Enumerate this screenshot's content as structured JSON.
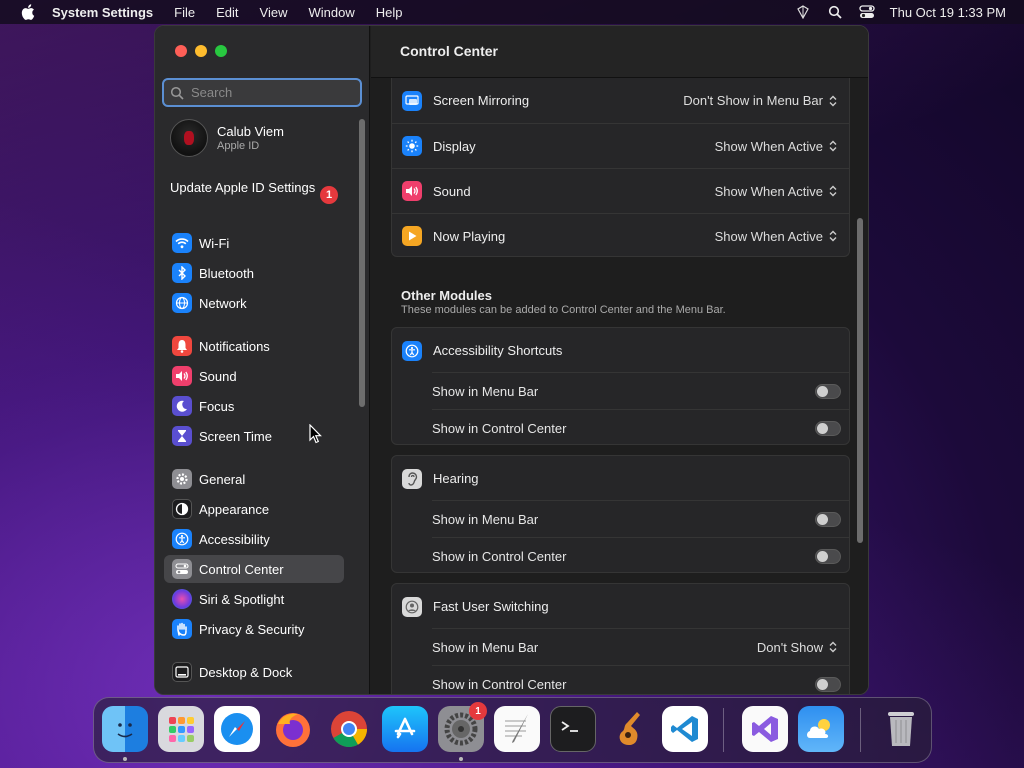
{
  "menubar": {
    "app_name": "System Settings",
    "menus": [
      "File",
      "Edit",
      "View",
      "Window",
      "Help"
    ],
    "clock": "Thu Oct 19  1:33 PM"
  },
  "window": {
    "search": {
      "placeholder": "Search"
    },
    "profile": {
      "name": "Calub Viem",
      "subtitle": "Apple ID"
    },
    "update_notice": {
      "label": "Update Apple ID Settings",
      "badge": "1"
    },
    "sidebar": {
      "items": [
        {
          "label": "Wi-Fi",
          "icon": "wifi-icon",
          "color": "#1a82fb"
        },
        {
          "label": "Bluetooth",
          "icon": "bluetooth-icon",
          "color": "#1a82fb"
        },
        {
          "label": "Network",
          "icon": "globe-icon",
          "color": "#1a82fb"
        },
        {
          "label": "Notifications",
          "icon": "bell-icon",
          "color": "#f0473e"
        },
        {
          "label": "Sound",
          "icon": "speaker-icon",
          "color": "#ef3f6c"
        },
        {
          "label": "Focus",
          "icon": "moon-icon",
          "color": "#5a4fd0"
        },
        {
          "label": "Screen Time",
          "icon": "hourglass-icon",
          "color": "#5a4fd0"
        },
        {
          "label": "General",
          "icon": "gear-icon",
          "color": "#8e8e93"
        },
        {
          "label": "Appearance",
          "icon": "appearance-icon",
          "color": "#1c1c1e"
        },
        {
          "label": "Accessibility",
          "icon": "accessibility-icon",
          "color": "#1a82fb"
        },
        {
          "label": "Control Center",
          "icon": "control-center-icon",
          "color": "#8e8e93"
        },
        {
          "label": "Siri & Spotlight",
          "icon": "siri-icon",
          "color": "#7a4ad8"
        },
        {
          "label": "Privacy & Security",
          "icon": "hand-icon",
          "color": "#1a82fb"
        },
        {
          "label": "Desktop & Dock",
          "icon": "dock-icon",
          "color": "#1c1c1e"
        }
      ],
      "active": "Control Center"
    }
  },
  "main": {
    "title": "Control Center",
    "control_center_modules": [
      {
        "label": "Screen Mirroring",
        "value": "Don't Show in Menu Bar",
        "icon": "screen-mirroring-icon",
        "color": "#1a82fb"
      },
      {
        "label": "Display",
        "value": "Show When Active",
        "icon": "sun-icon",
        "color": "#1a82fb"
      },
      {
        "label": "Sound",
        "value": "Show When Active",
        "icon": "speaker-icon",
        "color": "#ef3f6c"
      },
      {
        "label": "Now Playing",
        "value": "Show When Active",
        "icon": "play-icon",
        "color": "#f5a623"
      }
    ],
    "other_modules": {
      "title": "Other Modules",
      "subtitle": "These modules can be added to Control Center and the Menu Bar.",
      "groups": [
        {
          "label": "Accessibility Shortcuts",
          "icon": "accessibility-icon",
          "color": "#1a82fb",
          "rows": [
            {
              "label": "Show in Menu Bar",
              "toggle": false
            },
            {
              "label": "Show in Control Center",
              "toggle": false
            }
          ]
        },
        {
          "label": "Hearing",
          "icon": "ear-icon",
          "color": "#d9d9d9",
          "rows": [
            {
              "label": "Show in Menu Bar",
              "toggle": false
            },
            {
              "label": "Show in Control Center",
              "toggle": false
            }
          ]
        },
        {
          "label": "Fast User Switching",
          "icon": "user-icon",
          "color": "#d9d9d9",
          "rows": [
            {
              "label": "Show in Menu Bar",
              "value": "Don't Show"
            },
            {
              "label": "Show in Control Center",
              "toggle": false
            }
          ]
        }
      ]
    }
  },
  "dock": {
    "apps": [
      {
        "name": "Finder",
        "icon": "finder-icon",
        "running": true
      },
      {
        "name": "Launchpad",
        "icon": "launchpad-icon"
      },
      {
        "name": "Safari",
        "icon": "safari-icon"
      },
      {
        "name": "Firefox",
        "icon": "firefox-icon"
      },
      {
        "name": "Chrome",
        "icon": "chrome-icon"
      },
      {
        "name": "App Store",
        "icon": "app-store-icon"
      },
      {
        "name": "System Settings",
        "icon": "system-settings-icon",
        "badge": "1",
        "running": true
      },
      {
        "name": "TextEdit",
        "icon": "textedit-icon"
      },
      {
        "name": "Terminal",
        "icon": "terminal-icon"
      },
      {
        "name": "GarageBand",
        "icon": "garageband-icon"
      },
      {
        "name": "Visual Studio Code",
        "icon": "vscode-icon"
      },
      {
        "name": "Visual Studio",
        "icon": "visual-studio-icon"
      },
      {
        "name": "Weather",
        "icon": "weather-icon"
      },
      {
        "name": "Trash",
        "icon": "trash-icon"
      }
    ]
  }
}
